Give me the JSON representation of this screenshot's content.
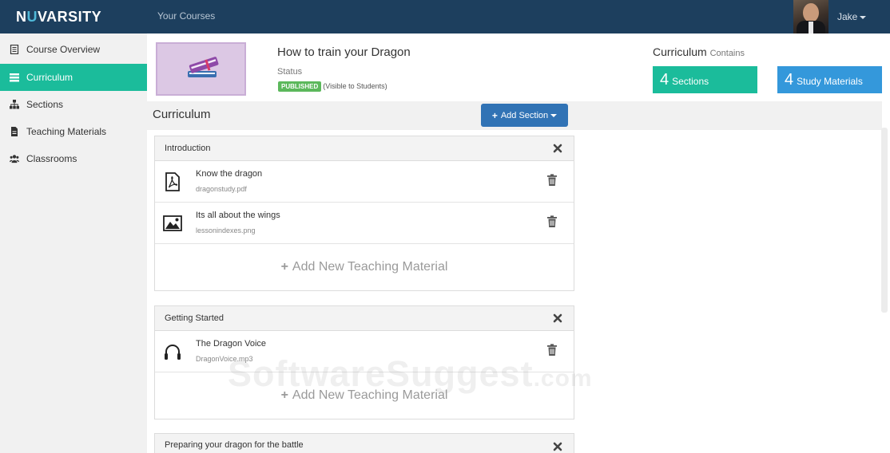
{
  "brand": {
    "logo_prefix": "N",
    "logo_nu": "U",
    "logo_rest": "VARSITY"
  },
  "nav": {
    "courses_label": "Your Courses",
    "user_name": "Jake"
  },
  "sidebar": {
    "items": [
      {
        "label": "Course Overview",
        "icon": "book-icon"
      },
      {
        "label": "Curriculum",
        "icon": "list-icon",
        "active": true
      },
      {
        "label": "Sections",
        "icon": "sitemap-icon"
      },
      {
        "label": "Teaching Materials",
        "icon": "document-icon"
      },
      {
        "label": "Classrooms",
        "icon": "users-icon"
      }
    ]
  },
  "course": {
    "title": "How to train your Dragon",
    "status_label": "Status",
    "status_badge": "PUBLISHED",
    "status_note": "(Visible to Students)"
  },
  "curriculum_summary": {
    "heading": "Curriculum",
    "heading_note": "Contains",
    "sections_count": "4",
    "sections_label": "Sections",
    "materials_count": "4",
    "materials_label": "Study Materials"
  },
  "curriculum": {
    "heading": "Curriculum",
    "add_section_label": "Add Section",
    "add_material_label": "Add New Teaching Material",
    "sections": [
      {
        "title": "Introduction",
        "materials": [
          {
            "name": "Know the dragon",
            "file": "dragonstudy.pdf",
            "icon": "pdf-icon"
          },
          {
            "name": "Its all about the wings",
            "file": "lessonindexes.png",
            "icon": "image-icon"
          }
        ]
      },
      {
        "title": "Getting Started",
        "materials": [
          {
            "name": "The Dragon Voice",
            "file": "DragonVoice.mp3",
            "icon": "headphones-icon"
          }
        ]
      },
      {
        "title": "Preparing your dragon for the battle",
        "materials": []
      }
    ]
  },
  "watermark": {
    "text": "SoftwareSuggest",
    "suffix": ".com"
  },
  "colors": {
    "navbar": "#1d3f5e",
    "accent_teal": "#1bbc9b",
    "accent_blue": "#3498db",
    "button_blue": "#3173b5",
    "published_green": "#5cb85c"
  }
}
